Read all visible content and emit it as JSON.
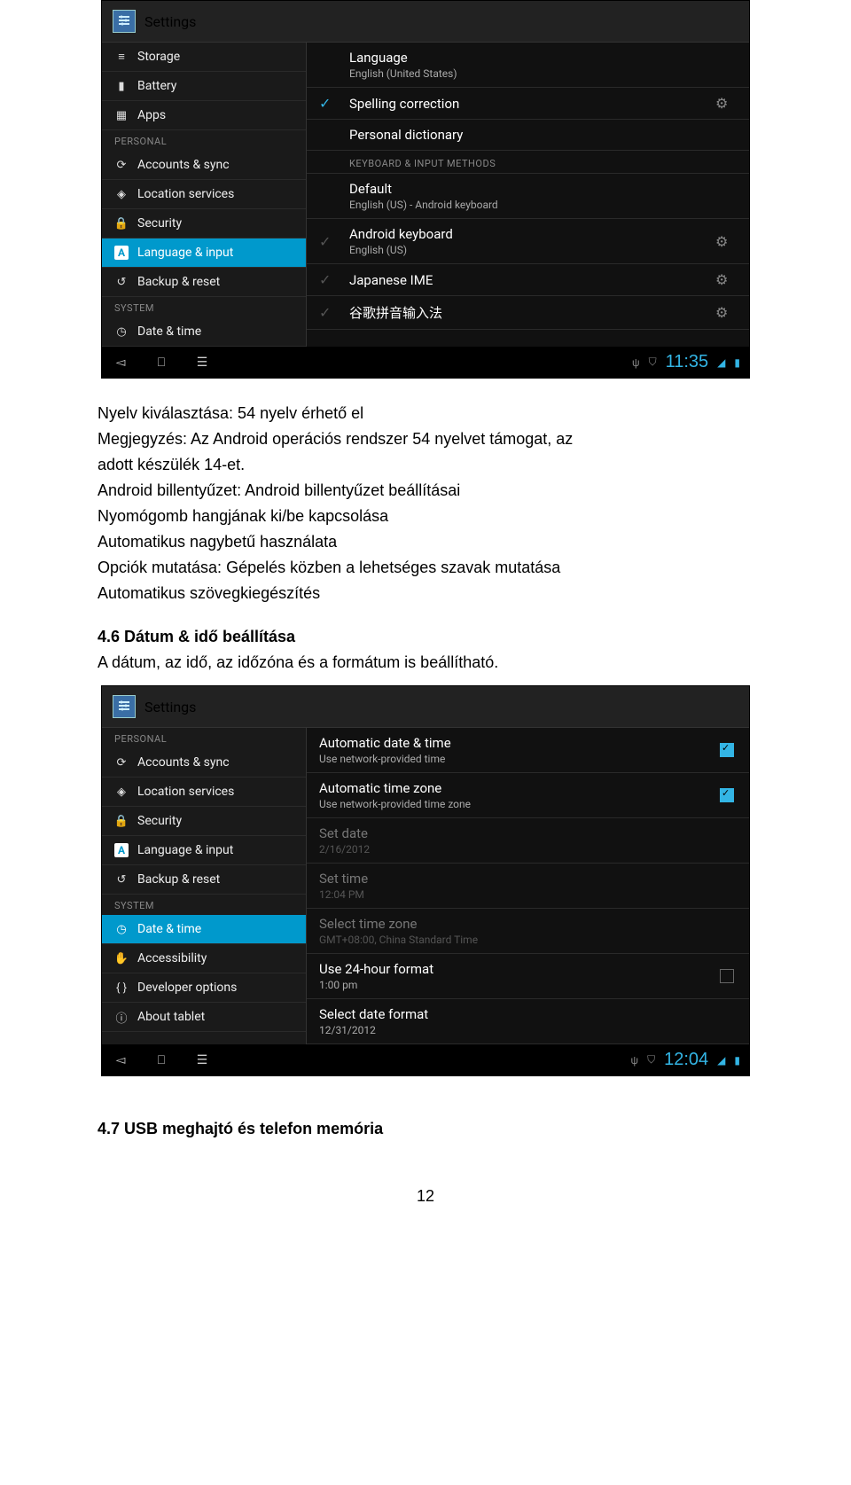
{
  "screenshot1": {
    "titlebar": "Settings",
    "sidebar_items": [
      {
        "icon": "storage-icon",
        "glyph": "≡",
        "label": "Storage"
      },
      {
        "icon": "battery-icon",
        "glyph": "▮",
        "label": "Battery"
      },
      {
        "icon": "apps-icon",
        "glyph": "▦",
        "label": "Apps"
      }
    ],
    "sidebar_header": "PERSONAL",
    "sidebar_items2": [
      {
        "icon": "sync-icon",
        "glyph": "⟳",
        "label": "Accounts & sync"
      },
      {
        "icon": "location-icon",
        "glyph": "◈",
        "label": "Location services"
      },
      {
        "icon": "lock-icon",
        "glyph": "🔒",
        "label": "Security"
      },
      {
        "icon": "language-icon",
        "glyph": "A",
        "label": "Language & input",
        "selected": true,
        "boxed": true
      },
      {
        "icon": "backup-icon",
        "glyph": "↺",
        "label": "Backup & reset"
      }
    ],
    "sidebar_header2": "SYSTEM",
    "sidebar_items3": [
      {
        "icon": "clock-icon",
        "glyph": "◷",
        "label": "Date & time"
      }
    ],
    "content_rows_top": [
      {
        "main": "Language",
        "sub": "English (United States)"
      },
      {
        "check": "on",
        "main": "Spelling correction",
        "slider": true
      },
      {
        "main": "Personal dictionary"
      }
    ],
    "content_header": "KEYBOARD & INPUT METHODS",
    "content_rows_bot": [
      {
        "main": "Default",
        "sub": "English (US) - Android keyboard"
      },
      {
        "check": "dim",
        "main": "Android keyboard",
        "sub": "English (US)",
        "slider": true
      },
      {
        "check": "dim",
        "main": "Japanese IME",
        "slider": true
      },
      {
        "check": "dim",
        "main": "谷歌拼音输入法",
        "slider": true
      }
    ],
    "clock": "11:35"
  },
  "doc_text": {
    "l1": "Nyelv kiválasztása: 54 nyelv érhető el",
    "l2": "Megjegyzés: Az Android operációs rendszer 54 nyelvet támogat, az",
    "l3": "adott készülék 14-et.",
    "l4": "Android billentyűzet: Android billentyűzet beállításai",
    "l5": "Nyomógomb hangjának ki/be kapcsolása",
    "l6": "Automatikus nagybetű használata",
    "l7": "Opciók mutatása: Gépelés közben a lehetséges szavak mutatása",
    "l8": "Automatikus szövegkiegészítés",
    "sec46": "4.6 Dátum & idő beállítása",
    "l9": "A dátum, az idő, az időzóna és a formátum is beállítható.",
    "sec47": "4.7 USB meghajtó és telefon memória"
  },
  "screenshot2": {
    "titlebar": "Settings",
    "sidebar_header": "PERSONAL",
    "sidebar_items": [
      {
        "icon": "sync-icon",
        "glyph": "⟳",
        "label": "Accounts & sync"
      },
      {
        "icon": "location-icon",
        "glyph": "◈",
        "label": "Location services"
      },
      {
        "icon": "lock-icon",
        "glyph": "🔒",
        "label": "Security"
      },
      {
        "icon": "language-icon",
        "glyph": "A",
        "label": "Language & input",
        "boxed": true
      },
      {
        "icon": "backup-icon",
        "glyph": "↺",
        "label": "Backup & reset"
      }
    ],
    "sidebar_header2": "SYSTEM",
    "sidebar_items2": [
      {
        "icon": "clock-icon",
        "glyph": "◷",
        "label": "Date & time",
        "selected": true
      },
      {
        "icon": "hand-icon",
        "glyph": "✋",
        "label": "Accessibility"
      },
      {
        "icon": "braces-icon",
        "glyph": "{ }",
        "label": "Developer options"
      },
      {
        "icon": "info-icon",
        "glyph": "ⓘ",
        "label": "About tablet"
      }
    ],
    "content_rows": [
      {
        "main": "Automatic date & time",
        "sub": "Use network-provided time",
        "box": "on"
      },
      {
        "main": "Automatic time zone",
        "sub": "Use network-provided time zone",
        "box": "on"
      },
      {
        "main": "Set date",
        "sub": "2/16/2012",
        "disabled": true
      },
      {
        "main": "Set time",
        "sub": "12:04 PM",
        "disabled": true
      },
      {
        "main": "Select time zone",
        "sub": "GMT+08:00, China Standard Time",
        "disabled": true
      },
      {
        "main": "Use 24-hour format",
        "sub": "1:00 pm",
        "box": "off"
      },
      {
        "main": "Select date format",
        "sub": "12/31/2012"
      }
    ],
    "clock": "12:04"
  },
  "page_number": "12"
}
